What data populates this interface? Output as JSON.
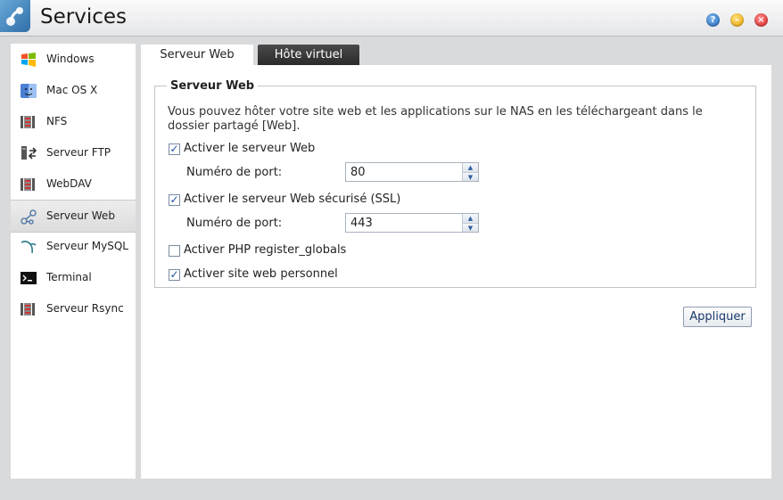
{
  "window": {
    "title": "Services"
  },
  "sidebar": {
    "items": [
      {
        "label": "Windows",
        "icon": "windows-logo-icon"
      },
      {
        "label": "Mac OS X",
        "icon": "mac-finder-icon"
      },
      {
        "label": "NFS",
        "icon": "nfs-server-icon"
      },
      {
        "label": "Serveur FTP",
        "icon": "ftp-server-icon"
      },
      {
        "label": "WebDAV",
        "icon": "webdav-server-icon"
      },
      {
        "label": "Serveur Web",
        "icon": "web-server-icon",
        "selected": true
      },
      {
        "label": "Serveur MySQL",
        "icon": "mysql-dolphin-icon"
      },
      {
        "label": "Terminal",
        "icon": "terminal-icon"
      },
      {
        "label": "Serveur Rsync",
        "icon": "rsync-server-icon"
      }
    ]
  },
  "tabs": [
    {
      "label": "Serveur Web",
      "active": true
    },
    {
      "label": "Hôte virtuel",
      "active": false
    }
  ],
  "panel": {
    "group_title": "Serveur Web",
    "description": "Vous pouvez hôter votre site web et les applications sur le NAS en les téléchargeant dans le dossier partagé [Web].",
    "enable_web": {
      "label": "Activer le serveur Web",
      "checked": true
    },
    "port_label": "Numéro de port:",
    "port_web": "80",
    "enable_ssl": {
      "label": "Activer le serveur Web sécurisé (SSL)",
      "checked": true
    },
    "port_ssl": "443",
    "register_globals": {
      "label": "Activer PHP register_globals",
      "checked": false
    },
    "personal_site": {
      "label": "Activer site web personnel",
      "checked": true
    },
    "apply_label": "Appliquer"
  },
  "colors": {
    "accent": "#1d4f9c",
    "tab_dark": "#2a2a2a",
    "background": "#d9dadc"
  }
}
